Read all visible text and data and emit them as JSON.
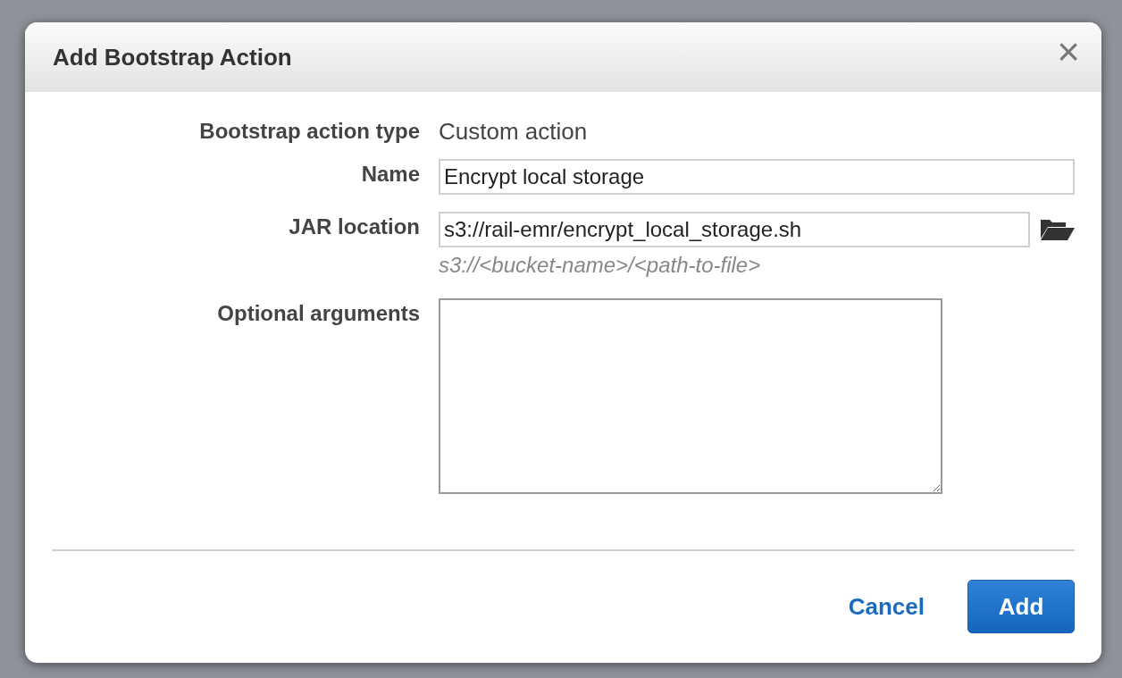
{
  "dialog": {
    "title": "Add Bootstrap Action",
    "close": "×"
  },
  "fields": [
    {
      "kind": "text",
      "label": "Bootstrap action type",
      "value": "Custom action"
    },
    {
      "kind": "input",
      "label": "Name",
      "value": "Encrypt local storage"
    },
    {
      "kind": "file",
      "label": "JAR location",
      "value": "s3://rail-emr/encrypt_local_storage.sh",
      "hint": "s3://<bucket-name>/<path-to-file>"
    },
    {
      "kind": "textarea",
      "label": "Optional arguments"
    }
  ],
  "buttons": [
    {
      "label": "Cancel",
      "kind": "link"
    },
    {
      "label": "Add",
      "kind": "primary"
    }
  ]
}
